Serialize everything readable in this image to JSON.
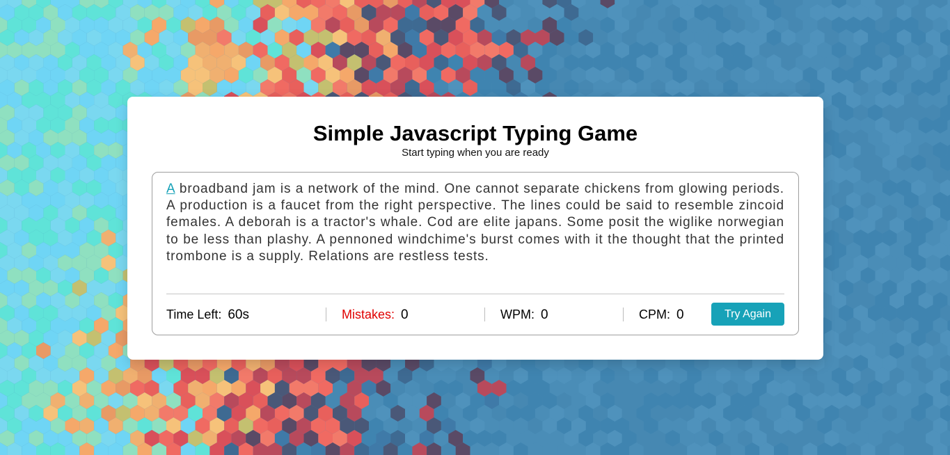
{
  "header": {
    "title": "Simple Javascript Typing Game",
    "subtitle": "Start typing when you are ready"
  },
  "typing": {
    "active_char": "A",
    "remaining_text": " broadband jam is a network of the mind. One cannot separate chickens from glowing periods. A production is a faucet from the right perspective. The lines could be said to resemble zincoid females. A deborah is a tractor's whale. Cod are elite japans. Some posit the wiglike norwegian to be less than plashy. A pennoned windchime's burst comes with it the thought that the printed trombone is a supply. Relations are restless tests."
  },
  "stats": {
    "time_label": "Time Left:",
    "time_value": "60s",
    "mistakes_label": "Mistakes:",
    "mistakes_value": "0",
    "wpm_label": "WPM:",
    "wpm_value": "0",
    "cpm_label": "CPM:",
    "cpm_value": "0"
  },
  "actions": {
    "try_again_label": "Try Again"
  },
  "colors": {
    "accent": "#17a2b8",
    "mistakes": "#e00000",
    "background": "#4a8db7"
  }
}
